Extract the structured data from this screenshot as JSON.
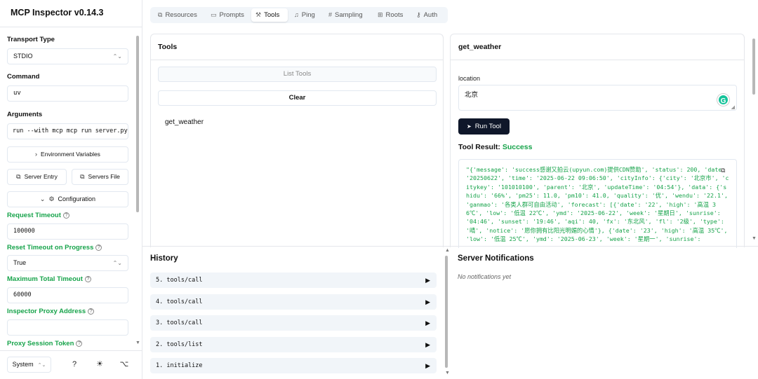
{
  "app": {
    "title": "MCP Inspector v0.14.3"
  },
  "sidebar": {
    "transport_label": "Transport Type",
    "transport_value": "STDIO",
    "command_label": "Command",
    "command_value": "uv",
    "arguments_label": "Arguments",
    "arguments_value": "run --with mcp mcp run server.py",
    "env_button": "Environment Variables",
    "server_entry_button": "Server Entry",
    "servers_file_button": "Servers File",
    "configuration_button": "Configuration",
    "request_timeout_label": "Request Timeout",
    "request_timeout_value": "100000",
    "reset_timeout_label": "Reset Timeout on Progress",
    "reset_timeout_value": "True",
    "max_timeout_label": "Maximum Total Timeout",
    "max_timeout_value": "60000",
    "proxy_address_label": "Inspector Proxy Address",
    "proxy_address_value": "",
    "proxy_token_label": "Proxy Session Token",
    "theme_value": "System",
    "icons": {
      "help": "help-circle-icon",
      "bug": "bug-icon",
      "github": "github-icon"
    }
  },
  "tabs": [
    {
      "label": "Resources",
      "icon": "resources-icon",
      "glyph": "⧉"
    },
    {
      "label": "Prompts",
      "icon": "prompts-icon",
      "glyph": "▭"
    },
    {
      "label": "Tools",
      "icon": "wrench-icon",
      "glyph": "⚒"
    },
    {
      "label": "Ping",
      "icon": "bell-icon",
      "glyph": "♫"
    },
    {
      "label": "Sampling",
      "icon": "hash-icon",
      "glyph": "#"
    },
    {
      "label": "Roots",
      "icon": "folder-tree-icon",
      "glyph": "⊞"
    },
    {
      "label": "Auth",
      "icon": "key-icon",
      "glyph": "⚷"
    }
  ],
  "active_tab": "Tools",
  "tools_panel": {
    "title": "Tools",
    "list_button": "List Tools",
    "clear_button": "Clear",
    "items": [
      "get_weather"
    ]
  },
  "tool_detail": {
    "title": "get_weather",
    "param_label": "location",
    "param_value": "北京",
    "run_button": "Run Tool",
    "result_label": "Tool Result:",
    "result_status": "Success",
    "result_text": "\"{'message': 'success感谢又拍云(upyun.com)提供CDN赞助', 'status': 200, 'date': '20250622', 'time': '2025-06-22 09:06:50', 'cityInfo': {'city': '北京市', 'citykey': '101010100', 'parent': '北京', 'updateTime': '04:54'}, 'data': {'shidu': '66%', 'pm25': 11.0, 'pm10': 41.0, 'quality': '优', 'wendu': '22.1', 'ganmao': '各类人群可自由活动', 'forecast': [{'date': '22', 'high': '高温 36℃', 'low': '低温 22℃', 'ymd': '2025-06-22', 'week': '星期日', 'sunrise': '04:46', 'sunset': '19:46', 'aqi': 40, 'fx': '东北风', 'fl': '2级', 'type': '晴', 'notice': '愿你拥有比阳光明媚的心情'}, {'date': '23', 'high': '高温 35℃', 'low': '低温 25℃', 'ymd': '2025-06-23', 'week': '星期一', 'sunrise':"
  },
  "history": {
    "title": "History",
    "items": [
      {
        "label": "5. tools/call"
      },
      {
        "label": "4. tools/call"
      },
      {
        "label": "3. tools/call"
      },
      {
        "label": "2. tools/list"
      },
      {
        "label": "1. initialize"
      }
    ]
  },
  "notifications": {
    "title": "Server Notifications",
    "empty_text": "No notifications yet"
  },
  "colors": {
    "accent_green": "#16a34a",
    "dark_button": "#0f172a"
  }
}
